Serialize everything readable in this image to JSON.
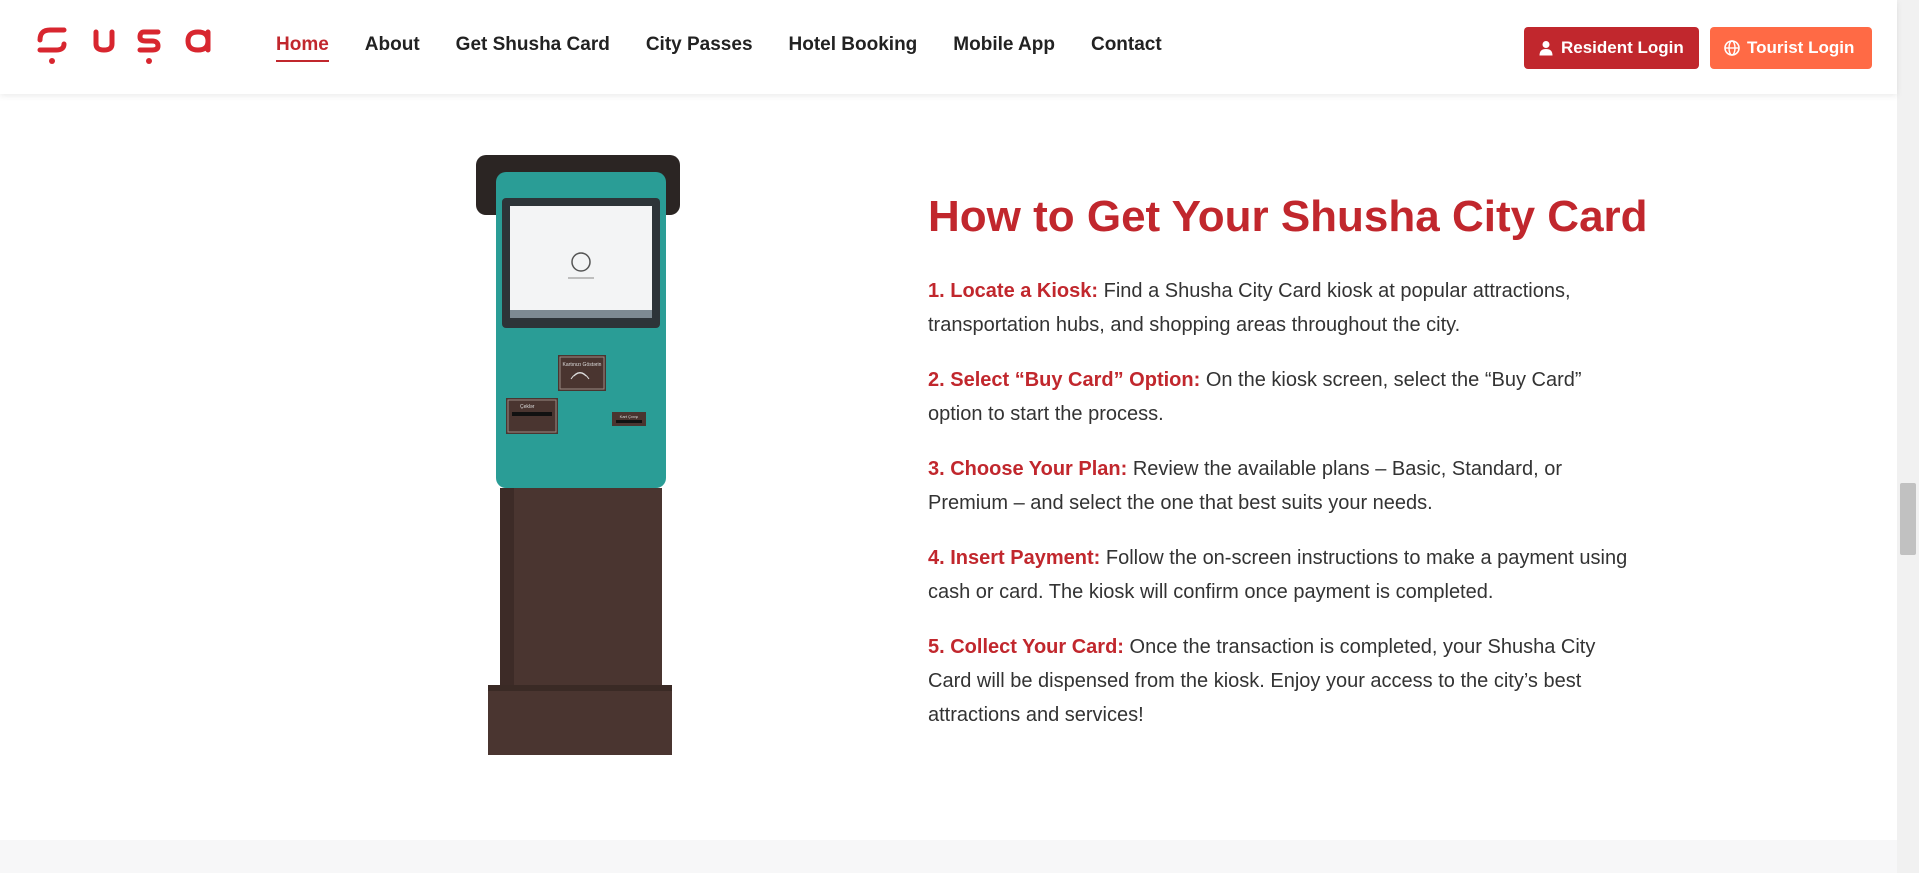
{
  "header": {
    "logo_text": "Şuşa",
    "nav": [
      "Home",
      "About",
      "Get Shusha Card",
      "City Passes",
      "Hotel Booking",
      "Mobile App",
      "Contact"
    ],
    "active_nav": "Home",
    "resident_login": "Resident Login",
    "tourist_login": "Tourist Login"
  },
  "main": {
    "heading": "How to Get Your Shusha City Card",
    "steps": [
      {
        "label": "1. Locate a Kiosk:",
        "text": " Find a Shusha City Card kiosk at popular attractions, transportation hubs, and shopping areas throughout the city."
      },
      {
        "label": "2. Select “Buy Card” Option:",
        "text": " On the kiosk screen, select the “Buy Card” option to start the process."
      },
      {
        "label": "3. Choose Your Plan:",
        "text": " Review the available plans – Basic, Standard, or Premium – and select the one that best suits your needs."
      },
      {
        "label": "4. Insert Payment:",
        "text": " Follow the on-screen instructions to make a payment using cash or card. The kiosk will confirm once payment is completed."
      },
      {
        "label": "5. Collect Your Card:",
        "text": " Once the transaction is completed, your Shusha City Card will be dispensed from the kiosk. Enjoy your access to the city’s best attractions and services!"
      }
    ]
  },
  "kiosk": {
    "card_label": "Kartınızı Göstərin",
    "cash_label": "Çeklər",
    "card_slot_label": "Kart Çıxışı"
  },
  "colors": {
    "brand_red": "#c1272d",
    "tourist_orange": "#ff6a45",
    "kiosk_teal": "#2a9d96",
    "kiosk_brown": "#4a3530"
  }
}
